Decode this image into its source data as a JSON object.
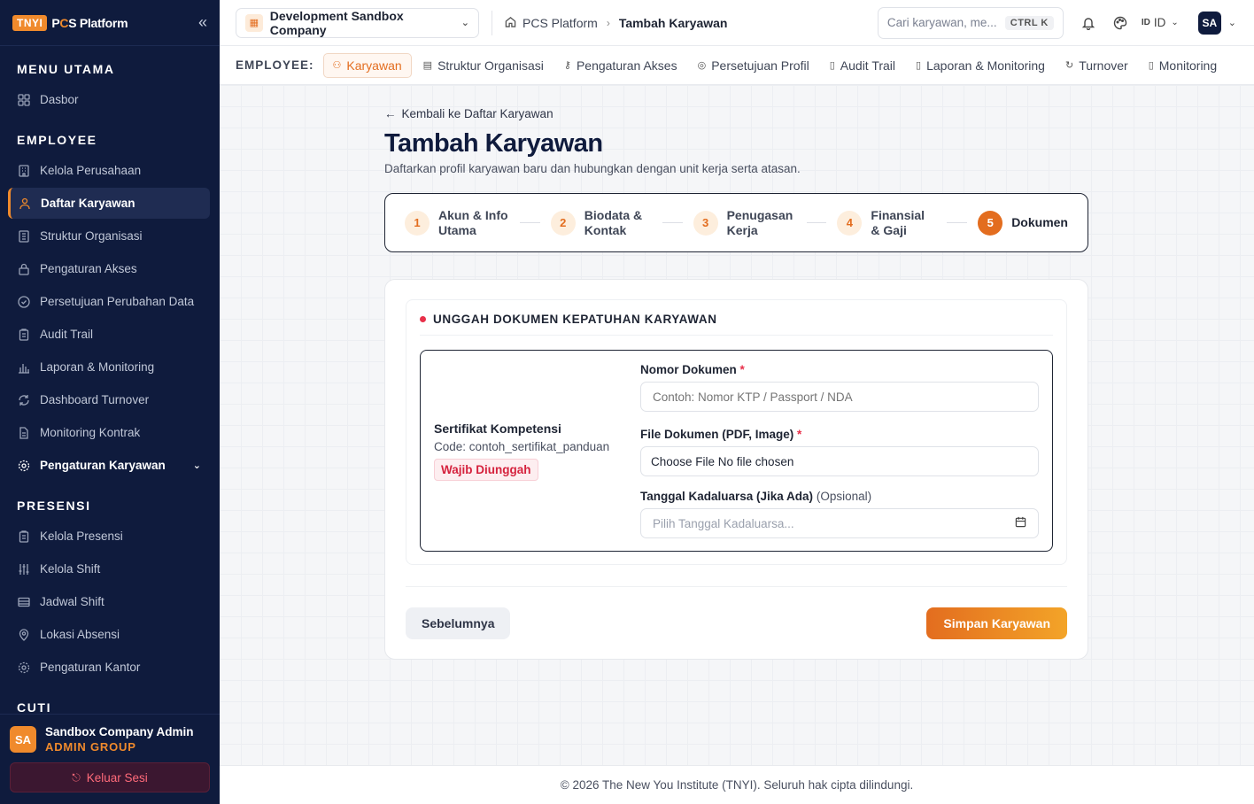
{
  "sidebar": {
    "logo_badge": "TNYI",
    "logo_text_a": "P",
    "logo_text_b": "C",
    "logo_text_c": "S Platform",
    "collapse_icon": "double-chevron-left-icon",
    "sections": [
      {
        "title": "MENU UTAMA",
        "items": [
          {
            "label": "Dasbor",
            "icon": "dashboard-icon"
          }
        ]
      },
      {
        "title": "EMPLOYEE",
        "items": [
          {
            "label": "Kelola Perusahaan",
            "icon": "building-icon"
          },
          {
            "label": "Daftar Karyawan",
            "icon": "users-icon",
            "active": true
          },
          {
            "label": "Struktur Organisasi",
            "icon": "org-icon"
          },
          {
            "label": "Pengaturan Akses",
            "icon": "lock-icon"
          },
          {
            "label": "Persetujuan Perubahan Data",
            "icon": "check-circle-icon"
          },
          {
            "label": "Audit Trail",
            "icon": "clipboard-icon"
          },
          {
            "label": "Laporan & Monitoring",
            "icon": "bar-chart-icon"
          },
          {
            "label": "Dashboard Turnover",
            "icon": "refresh-icon"
          },
          {
            "label": "Monitoring Kontrak",
            "icon": "document-icon"
          },
          {
            "label": "Pengaturan Karyawan",
            "icon": "gear-icon",
            "expandable": true
          }
        ]
      },
      {
        "title": "PRESENSI",
        "items": [
          {
            "label": "Kelola Presensi",
            "icon": "clipboard-icon"
          },
          {
            "label": "Kelola Shift",
            "icon": "sliders-icon"
          },
          {
            "label": "Jadwal Shift",
            "icon": "table-icon"
          },
          {
            "label": "Lokasi Absensi",
            "icon": "map-pin-icon"
          },
          {
            "label": "Pengaturan Kantor",
            "icon": "gear-icon"
          }
        ]
      },
      {
        "title": "CUTI",
        "items": []
      }
    ],
    "user": {
      "initials": "SA",
      "name": "Sandbox Company Admin",
      "role": "ADMIN GROUP"
    },
    "logout_label": "Keluar Sesi"
  },
  "header": {
    "company": "Development Sandbox Company",
    "breadcrumb": [
      "PCS Platform",
      "Tambah Karyawan"
    ],
    "search_placeholder": "Cari karyawan, me...",
    "search_shortcut": "CTRL K",
    "lang_flag": "ID",
    "lang": "ID",
    "user_initials": "SA"
  },
  "subnav": {
    "label": "EMPLOYEE:",
    "tabs": [
      {
        "label": "Karyawan",
        "active": true
      },
      {
        "label": "Struktur Organisasi"
      },
      {
        "label": "Pengaturan Akses"
      },
      {
        "label": "Persetujuan Profil"
      },
      {
        "label": "Audit Trail"
      },
      {
        "label": "Laporan & Monitoring"
      },
      {
        "label": "Turnover"
      },
      {
        "label": "Monitoring"
      }
    ]
  },
  "page": {
    "back_label": "Kembali ke Daftar Karyawan",
    "title": "Tambah Karyawan",
    "subtitle": "Daftarkan profil karyawan baru dan hubungkan dengan unit kerja serta atasan.",
    "steps": [
      {
        "num": "1",
        "label": "Akun & Info Utama"
      },
      {
        "num": "2",
        "label": "Biodata & Kontak"
      },
      {
        "num": "3",
        "label": "Penugasan Kerja"
      },
      {
        "num": "4",
        "label": "Finansial & Gaji"
      },
      {
        "num": "5",
        "label": "Dokumen",
        "active": true
      }
    ],
    "section_title": "UNGGAH DOKUMEN KEPATUHAN KARYAWAN",
    "document": {
      "name": "Sertifikat Kompetensi",
      "code": "Code: contoh_sertifikat_panduan",
      "badge": "Wajib Diunggah"
    },
    "fields": {
      "nomor_label": "Nomor Dokumen",
      "nomor_placeholder": "Contoh: Nomor KTP / Passport / NDA",
      "file_label": "File Dokumen (PDF, Image)",
      "file_value": "Choose File No file chosen",
      "expiry_label": "Tanggal Kadaluarsa (Jika Ada)",
      "expiry_optional": "(Opsional)",
      "expiry_placeholder": "Pilih Tanggal Kadaluarsa...",
      "required_mark": "*"
    },
    "prev_label": "Sebelumnya",
    "save_label": "Simpan Karyawan"
  },
  "footer": {
    "text": "© 2026 The New You Institute (TNYI). Seluruh hak cipta dilindungi."
  }
}
